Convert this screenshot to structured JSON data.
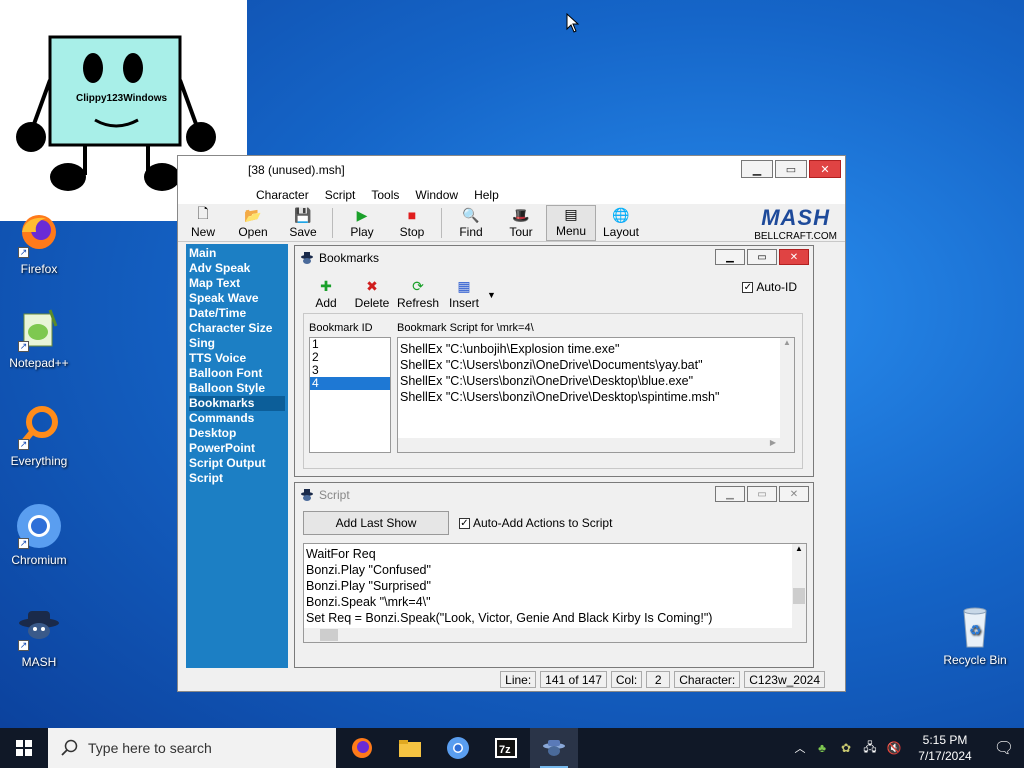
{
  "overlay": {
    "label": "Clippy123Windows"
  },
  "desktop": {
    "icons": [
      "Firefox",
      "Notepad++",
      "Everything",
      "Chromium",
      "MASH",
      "Recycle Bin"
    ]
  },
  "window": {
    "title": "[38 (unused).msh]",
    "menu": [
      "Character",
      "Script",
      "Tools",
      "Window",
      "Help"
    ],
    "toolbar": [
      "New",
      "Open",
      "Save",
      "Play",
      "Stop",
      "Find",
      "Tour",
      "Menu",
      "Layout"
    ],
    "logo": {
      "main": "MASH",
      "sub": "BELLCRAFT.COM"
    },
    "side_items": [
      "Main",
      "Adv Speak",
      "Map Text",
      "Speak Wave",
      "Date/Time",
      "Character Size",
      "Sing",
      "TTS Voice",
      "Balloon Font",
      "Balloon Style",
      "Bookmarks",
      "Commands",
      "Desktop",
      "PowerPoint",
      "Script Output",
      "Script"
    ],
    "side_selected": "Bookmarks",
    "status": {
      "line_label": "Line:",
      "line_value": "141 of 147",
      "col_label": "Col:",
      "col_value": "2",
      "char_label": "Character:",
      "char_value": "C123w_2024"
    }
  },
  "bookmarks": {
    "title": "Bookmarks",
    "tools": [
      "Add",
      "Delete",
      "Refresh",
      "Insert"
    ],
    "auto_id": "Auto-ID",
    "id_header": "Bookmark ID",
    "script_header": "Bookmark Script for \\mrk=4\\",
    "ids": [
      "1",
      "2",
      "3",
      "4"
    ],
    "selected_id": "4",
    "script_lines": [
      "ShellEx \"C:\\unbojih\\Explosion time.exe\"",
      "ShellEx \"C:\\Users\\bonzi\\OneDrive\\Documents\\yay.bat\"",
      "ShellEx \"C:\\Users\\bonzi\\OneDrive\\Desktop\\blue.exe\"",
      "ShellEx \"C:\\Users\\bonzi\\OneDrive\\Desktop\\spintime.msh\""
    ]
  },
  "script": {
    "title": "Script",
    "add_last_show": "Add Last Show",
    "auto_add": "Auto-Add Actions to Script",
    "lines": [
      "WaitFor Req",
      "Bonzi.Play \"Confused\"",
      "Bonzi.Play \"Surprised\"",
      "Bonzi.Speak \"\\mrk=4\\\"",
      "Set Req = Bonzi.Speak(\"Look, Victor, Genie And Black Kirby Is Coming!\")"
    ]
  },
  "taskbar": {
    "search_placeholder": "Type here to search",
    "time": "5:15 PM",
    "date": "7/17/2024"
  },
  "colors": {
    "side_panel": "#1c7fc4",
    "selection": "#1e78d4",
    "close": "#e04343",
    "taskbar": "#101827"
  }
}
